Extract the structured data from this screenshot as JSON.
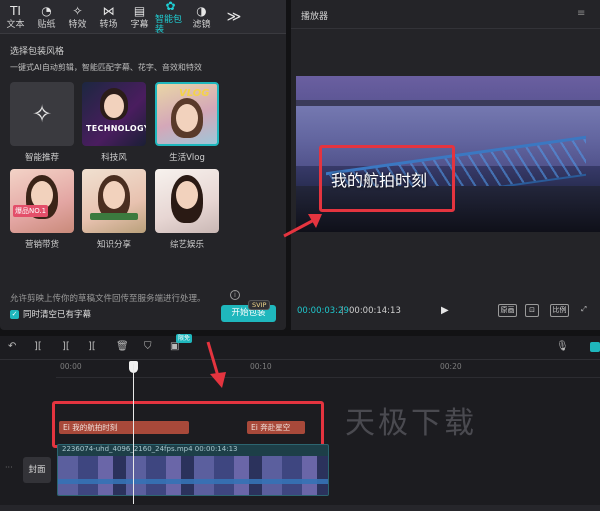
{
  "toolbar": {
    "tabs": [
      {
        "label": "文本",
        "icon": "text-icon",
        "glyph": "TI"
      },
      {
        "label": "贴纸",
        "icon": "sticker-icon",
        "glyph": "◔"
      },
      {
        "label": "特效",
        "icon": "effects-icon",
        "glyph": "✧"
      },
      {
        "label": "转场",
        "icon": "transition-icon",
        "glyph": "⋈"
      },
      {
        "label": "字幕",
        "icon": "subtitle-icon",
        "glyph": "▤"
      },
      {
        "label": "智能包装",
        "icon": "smart-pack-icon",
        "glyph": "✿"
      },
      {
        "label": "滤镜",
        "icon": "filter-icon",
        "glyph": "◑"
      }
    ],
    "active_tab": "智能包装",
    "more": "≫"
  },
  "panel": {
    "title": "选择包装风格",
    "subtitle": "一键式AI自动剪辑，智能匹配字幕、花字、音效和特效",
    "styles": [
      {
        "label": "智能推荐",
        "icon": "sparkle-icon"
      },
      {
        "label": "科技风",
        "overlay": "TECHNOLOGY"
      },
      {
        "label": "生活Vlog",
        "overlay": "VLOG"
      },
      {
        "label": "营销带货",
        "overlay": "爆品NO.1"
      },
      {
        "label": "知识分享",
        "overlay": ""
      },
      {
        "label": "综艺娱乐",
        "overlay": ""
      }
    ],
    "notice": "允许剪映上传你的草稿文件回传至服务端进行处理。",
    "checkbox_label": "同时清空已有字幕",
    "checkbox_checked": true,
    "start_button": "开始包装",
    "svip": "SVIP"
  },
  "player": {
    "title": "播放器",
    "subtitle_text": "我的航拍时刻",
    "time_current": "00:00:03:29",
    "time_total": "00:00:14:13",
    "buttons": [
      "原画",
      "⊡",
      "比例",
      "⤢"
    ]
  },
  "timeline": {
    "tools": [
      "↶",
      "][",
      "][",
      "][",
      "🗑",
      "⛉",
      "▣"
    ],
    "free_badge": "限免",
    "ruler": [
      "00:00",
      "00:10",
      "00:20"
    ],
    "clips": [
      {
        "label": "我的航拍时刻",
        "prefix": "Ei"
      },
      {
        "label": "奔赴星空",
        "prefix": "Ei"
      }
    ],
    "video_name": "2236074-uhd_4096_2160_24fps.mp4 00:00:14:13",
    "cover_label": "封面",
    "watermark": "天极下载"
  },
  "colors": {
    "accent": "#1fb7bd",
    "highlight": "#e4343f",
    "clip": "#a8493a"
  }
}
